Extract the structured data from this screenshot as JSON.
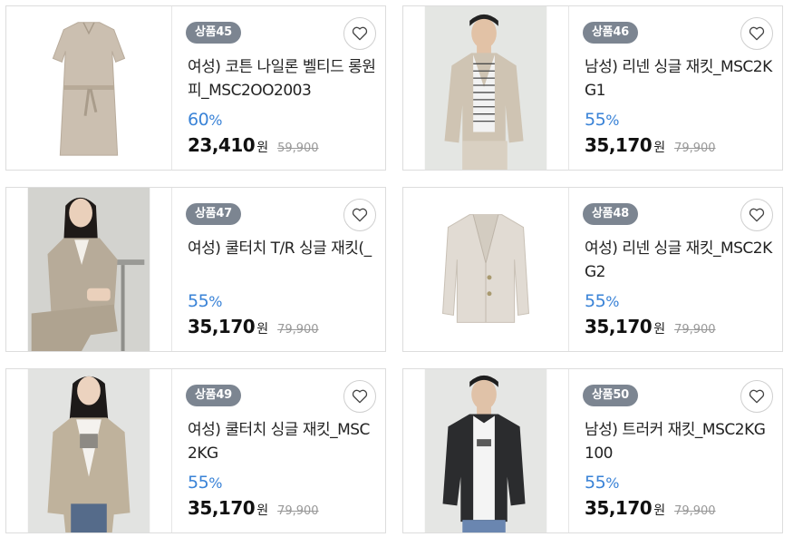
{
  "currency_unit": "원",
  "products": [
    {
      "badge": "상품45",
      "title": "여성) 코튼 나일론 벨티드 롱원피_MSC2OO2003",
      "discount": "60",
      "percent": "%",
      "price": "23,410",
      "original": "59,900",
      "image": "beige-belted-dress"
    },
    {
      "badge": "상품46",
      "title": "남성) 리넨 싱글 재킷_MSC2KG1",
      "discount": "55",
      "percent": "%",
      "price": "35,170",
      "original": "79,900",
      "image": "man-linen-jacket"
    },
    {
      "badge": "상품47",
      "title": "여성) 쿨터치 T/R 싱글 재킷(_",
      "discount": "55",
      "percent": "%",
      "price": "35,170",
      "original": "79,900",
      "image": "woman-seated-suit"
    },
    {
      "badge": "상품48",
      "title": "여성) 리넨 싱글 재킷_MSC2KG2",
      "discount": "55",
      "percent": "%",
      "price": "35,170",
      "original": "79,900",
      "image": "linen-jacket-flat"
    },
    {
      "badge": "상품49",
      "title": "여성) 쿨터치 싱글 재킷_MSC2KG",
      "discount": "55",
      "percent": "%",
      "price": "35,170",
      "original": "79,900",
      "image": "woman-beige-blazer"
    },
    {
      "badge": "상품50",
      "title": "남성) 트러커 재킷_MSC2KG100",
      "discount": "55",
      "percent": "%",
      "price": "35,170",
      "original": "79,900",
      "image": "man-trucker-jacket"
    }
  ]
}
